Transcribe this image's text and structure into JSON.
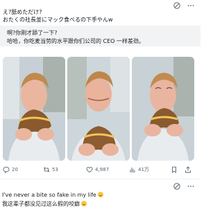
{
  "post": {
    "text_line1": "え?舐めただけ?",
    "text_line2": "おたくの社長並にマック食べるの下手やんw",
    "translation_line1": "啊?你刚才舔了一下?",
    "translation_line2": "哈哈，你吃麦当劳的水平跟你们公司的 CEO 一样差劲。",
    "stats": {
      "replies": "20",
      "reposts": "53",
      "likes": "4,987",
      "views": "41万"
    }
  },
  "reply": {
    "line1": "I've never a bite so fake in my life",
    "line2": "我这辈子都没见过这么假的咬癖"
  },
  "colors": {
    "text": "#0f1419",
    "muted": "#536471",
    "translation_bg": "#f2f3f4"
  }
}
